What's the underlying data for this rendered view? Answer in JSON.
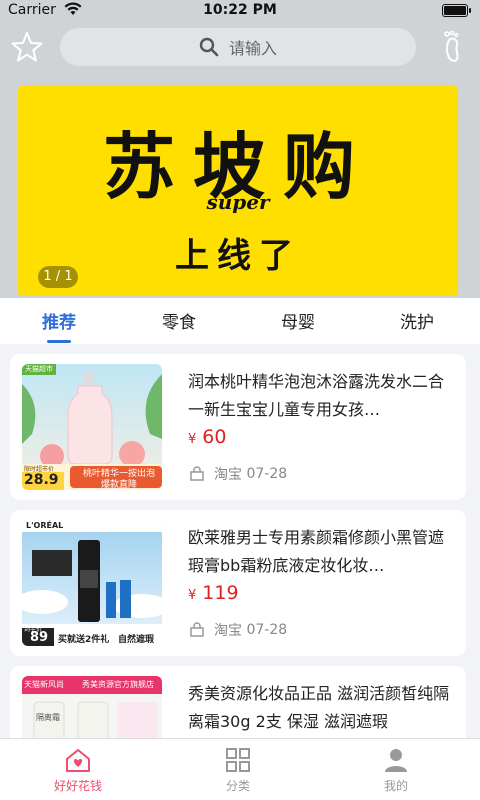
{
  "status_bar": {
    "carrier": "Carrier",
    "time": "10:22 PM"
  },
  "search": {
    "placeholder": "请输入"
  },
  "banner": {
    "headline": "苏坡购",
    "subline": "super",
    "tagline": "上线了",
    "pager": "1 / 1"
  },
  "category_tabs": [
    {
      "label": "推荐",
      "active": true
    },
    {
      "label": "零食",
      "active": false
    },
    {
      "label": "母婴",
      "active": false
    },
    {
      "label": "洗护",
      "active": false
    }
  ],
  "products": [
    {
      "title": "润本桃叶精华泡泡沐浴露洗发水二合一新生宝宝儿童专用女孩…",
      "currency": "¥",
      "price": "60",
      "source": "淘宝",
      "date": "07-28",
      "thumb": {
        "badge": "天猫超市",
        "promo": "桃叶精华一按出泡",
        "sub": "爆款直降",
        "tag_price": "28.9",
        "tag_note": "限时超市价"
      }
    },
    {
      "title": "欧莱雅男士专用素颜霜修颜小黑管遮瑕膏bb霜粉底液定妆化妆…",
      "currency": "¥",
      "price": "119",
      "source": "淘宝",
      "date": "07-28",
      "thumb": {
        "brand": "L'ORÉAL",
        "promo": "买就送2件礼",
        "sub": "自然遮瑕",
        "tag_price": "89",
        "tag_note": "到手价"
      }
    },
    {
      "title": "秀美资源化妆品正品 滋润活颜皙纯隔离霜30g 2支 保湿 滋润遮瑕",
      "currency": "",
      "price": "",
      "source": "",
      "date": "",
      "thumb": {
        "badge": "天猫新风尚",
        "banner": "秀美资源官方旗舰店",
        "label": "隔离霜"
      }
    }
  ],
  "bottom_tabs": [
    {
      "label": "好好花钱",
      "icon": "home-heart-icon",
      "active": true
    },
    {
      "label": "分类",
      "icon": "grid-icon",
      "active": false
    },
    {
      "label": "我的",
      "icon": "user-icon",
      "active": false
    }
  ],
  "colors": {
    "accent": "#2f6fd6",
    "price": "#e02020",
    "tab_active": "#ef4e6e",
    "banner_bg": "#ffdf00"
  }
}
